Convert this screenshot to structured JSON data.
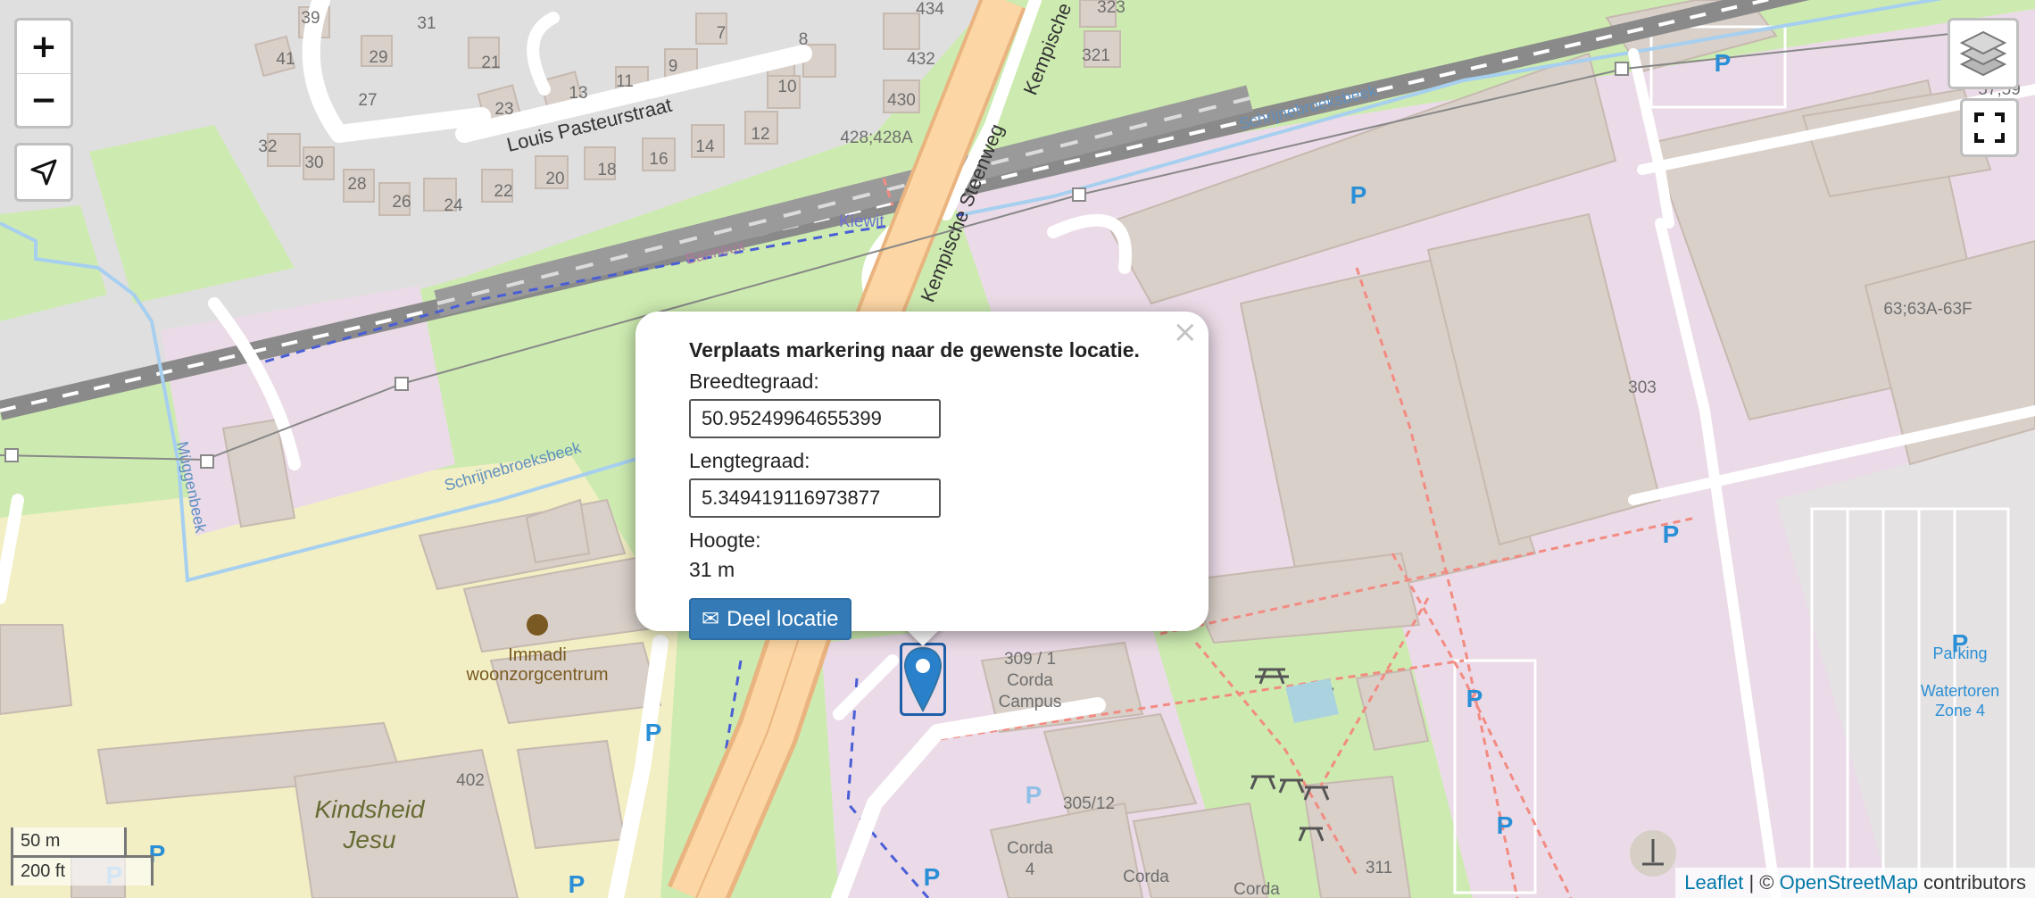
{
  "controls": {
    "zoom_in": "+",
    "zoom_out": "−"
  },
  "popup": {
    "close": "×",
    "title": "Verplaats markering naar de gewenste locatie.",
    "latitude_label": "Breedtegraad:",
    "latitude_value": "50.95249964655399",
    "longitude_label": "Lengtegraad:",
    "longitude_value": "5.349419116973877",
    "altitude_label": "Hoogte:",
    "altitude_value": "31 m",
    "share_button": "Deel locatie",
    "share_icon": "✉"
  },
  "scale": {
    "metric": "50 m",
    "imperial": "200 ft"
  },
  "attribution": {
    "leaflet": "Leaflet",
    "separator": " | © ",
    "osm": "OpenStreetMap",
    "suffix": " contributors"
  },
  "map_labels": {
    "street_louis": "Louis Pasteurstraat",
    "street_kempische": "Kempische Steenweg",
    "street_kempische_top": "Kempische",
    "station": "Kiewit",
    "banneux": "Banneux",
    "brook_1": "Schrijnebroeksbeek",
    "brook_2": "Schrijnebroeksbeek",
    "brook_muggen": "Müggenbeek",
    "immadi_1": "Immadi",
    "immadi_2": "woonzorgcentrum",
    "kindsheid_1": "Kindsheid",
    "kindsheid_2": "Jesu",
    "corda_campus_1": "309 / 1",
    "corda_campus_2": "Corda",
    "corda_campus_3": "Campus",
    "corda4_1": "Corda",
    "corda4_2": "4",
    "corda_a": "Corda",
    "corda_b": "Corda",
    "parking_1": "Parking",
    "parking_2": "Watertoren",
    "parking_3": "Zone 4",
    "parking_p": "P",
    "n_39": "39",
    "n_31": "31",
    "n_41": "41",
    "n_29": "29",
    "n_21": "21",
    "n_7": "7",
    "n_27": "27",
    "n_23": "23",
    "n_13": "13",
    "n_11": "11",
    "n_9": "9",
    "n_8": "8",
    "n_10": "10",
    "n_32": "32",
    "n_30": "30",
    "n_28": "28",
    "n_26": "26",
    "n_24": "24",
    "n_22": "22",
    "n_20": "20",
    "n_18": "18",
    "n_16": "16",
    "n_14": "14",
    "n_12": "12",
    "n_434": "434",
    "n_432": "432",
    "n_430": "430",
    "n_428": "428;428A",
    "n_323": "323",
    "n_321": "321",
    "n_5759": "57;59",
    "n_63": "63;63A-63F",
    "n_303": "303",
    "n_402": "402",
    "n_30512": "305/12",
    "n_311": "311"
  }
}
